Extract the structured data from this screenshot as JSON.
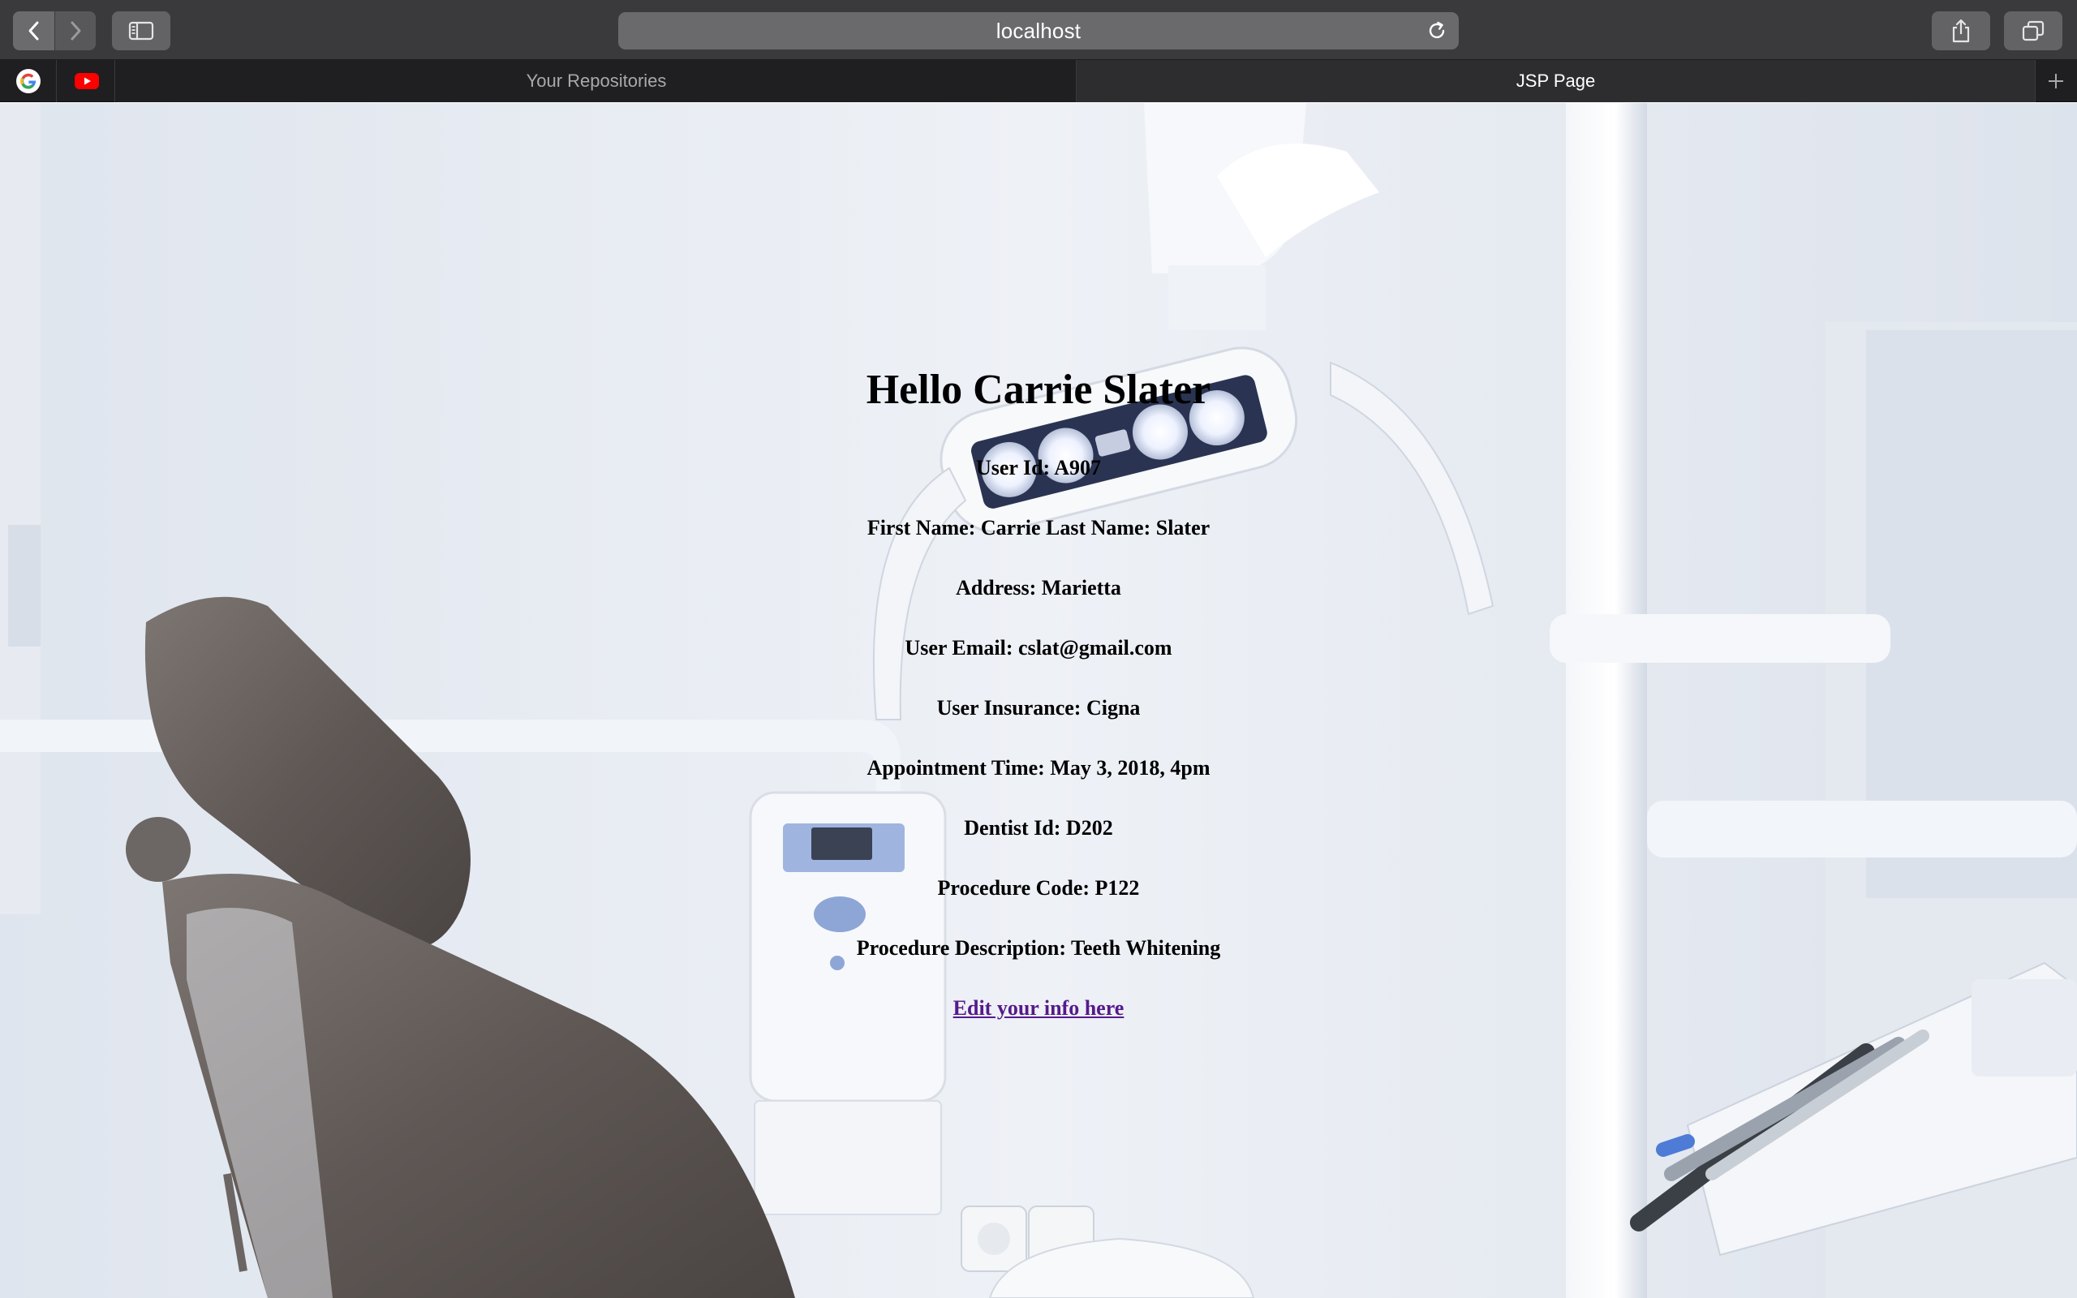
{
  "browser": {
    "url": "localhost",
    "tabs": [
      {
        "label": "Your Repositories",
        "active": false
      },
      {
        "label": "JSP Page",
        "active": true
      }
    ],
    "favorites": [
      {
        "icon": "google-icon"
      },
      {
        "icon": "youtube-icon"
      }
    ]
  },
  "page": {
    "greeting": "Hello Carrie Slater",
    "info": {
      "user_id": "User Id: A907",
      "name": "First Name: Carrie Last Name: Slater",
      "address": "Address: Marietta",
      "email": "User Email: cslat@gmail.com",
      "insurance": "User Insurance: Cigna",
      "appointment": "Appointment Time: May 3, 2018, 4pm",
      "dentist": "Dentist Id: D202",
      "procedure_code": "Procedure Code: P122",
      "procedure_description": "Procedure Description: Teeth Whitening"
    },
    "edit_link": "Edit your info here",
    "link_color": "#551a8b"
  }
}
